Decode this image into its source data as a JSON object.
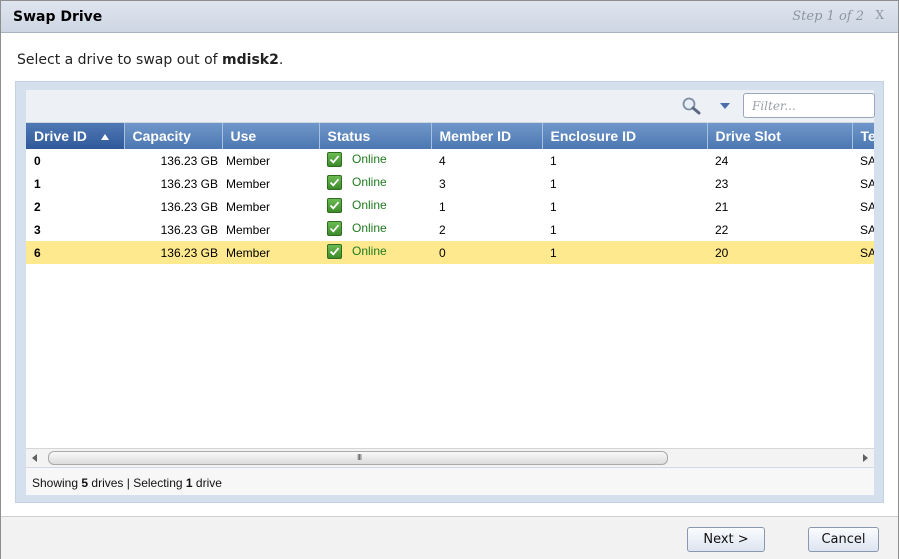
{
  "dialog": {
    "title": "Swap Drive",
    "step": "Step 1 of 2",
    "close_label": "X"
  },
  "instruction": {
    "prefix": "Select a drive to swap out of ",
    "mdisk": "mdisk2",
    "suffix": "."
  },
  "toolbar": {
    "search_icon": "magnifier-icon",
    "filter_placeholder": "Filter..."
  },
  "table": {
    "columns": [
      "Drive ID",
      "Capacity",
      "Use",
      "Status",
      "Member ID",
      "Enclosure ID",
      "Drive Slot",
      "Tec"
    ],
    "sorted_column": "Drive ID",
    "sort_direction": "ascending",
    "rows": [
      {
        "drive_id": "0",
        "capacity": "136.23 GB",
        "use": "Member",
        "status": "Online",
        "member_id": "4",
        "enclosure_id": "1",
        "drive_slot": "24",
        "tech": "SAS"
      },
      {
        "drive_id": "1",
        "capacity": "136.23 GB",
        "use": "Member",
        "status": "Online",
        "member_id": "3",
        "enclosure_id": "1",
        "drive_slot": "23",
        "tech": "SAS"
      },
      {
        "drive_id": "2",
        "capacity": "136.23 GB",
        "use": "Member",
        "status": "Online",
        "member_id": "1",
        "enclosure_id": "1",
        "drive_slot": "21",
        "tech": "SAS"
      },
      {
        "drive_id": "3",
        "capacity": "136.23 GB",
        "use": "Member",
        "status": "Online",
        "member_id": "2",
        "enclosure_id": "1",
        "drive_slot": "22",
        "tech": "SAS"
      },
      {
        "drive_id": "6",
        "capacity": "136.23 GB",
        "use": "Member",
        "status": "Online",
        "member_id": "0",
        "enclosure_id": "1",
        "drive_slot": "20",
        "tech": "SAS"
      }
    ],
    "selected_row": 4
  },
  "statusbar": {
    "showing_prefix": "Showing ",
    "showing_count": "5",
    "showing_mid": " drives | Selecting ",
    "selecting_count": "1",
    "selecting_suffix": " drive"
  },
  "buttons": {
    "next": "Next >",
    "cancel": "Cancel"
  },
  "colors": {
    "header_blue": "#4c77b1",
    "selected_row": "#ffe98e",
    "online_green": "#1f7a1f"
  }
}
